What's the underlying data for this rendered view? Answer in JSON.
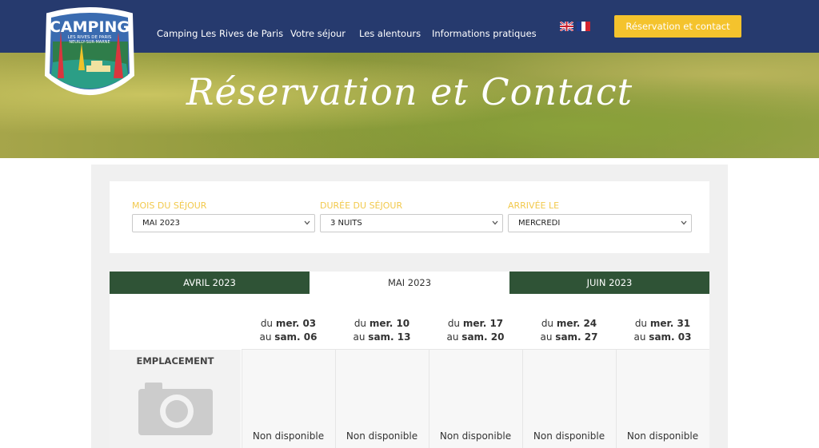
{
  "header": {
    "logo": {
      "title": "CAMPING",
      "subtitle_line1": "LES RIVES DE PARIS",
      "subtitle_line2": "NEUILLY-SUR-MARNE"
    },
    "nav": [
      {
        "label": "Camping Les Rives de Paris"
      },
      {
        "label": "Votre séjour"
      },
      {
        "label": "Les alentours"
      },
      {
        "label": "Informations pratiques"
      }
    ],
    "languages": [
      "en-flag",
      "fr-flag"
    ],
    "cta_label": "Réservation et contact"
  },
  "hero": {
    "title": "Réservation et Contact"
  },
  "filters": [
    {
      "label": "MOIS DU SÉJOUR",
      "value": "MAI 2023"
    },
    {
      "label": "DURÉE DU SÉJOUR",
      "value": "3 NUITS"
    },
    {
      "label": "ARRIVÉE LE",
      "value": "MERCREDI"
    }
  ],
  "month_tabs": [
    {
      "label": "AVRIL 2023",
      "active": false
    },
    {
      "label": "MAI 2023",
      "active": true
    },
    {
      "label": "JUIN 2023",
      "active": false
    }
  ],
  "periods": [
    {
      "from_prefix": "du",
      "from_day": "mer. 03",
      "to_prefix": "au",
      "to_day": "sam. 06",
      "status": "Non disponible"
    },
    {
      "from_prefix": "du",
      "from_day": "mer. 10",
      "to_prefix": "au",
      "to_day": "sam. 13",
      "status": "Non disponible"
    },
    {
      "from_prefix": "du",
      "from_day": "mer. 17",
      "to_prefix": "au",
      "to_day": "sam. 20",
      "status": "Non disponible"
    },
    {
      "from_prefix": "du",
      "from_day": "mer. 24",
      "to_prefix": "au",
      "to_day": "sam. 27",
      "status": "Non disponible"
    },
    {
      "from_prefix": "du",
      "from_day": "mer. 31",
      "to_prefix": "au",
      "to_day": "sam. 03",
      "status": "Non disponible"
    }
  ],
  "row": {
    "label": "EMPLACEMENT",
    "image_icon": "camera-icon"
  },
  "colors": {
    "header_bg": "#263a6e",
    "accent_yellow": "#f4c32d",
    "tab_green": "#2f5336",
    "label_yellow": "#f2c94c"
  }
}
